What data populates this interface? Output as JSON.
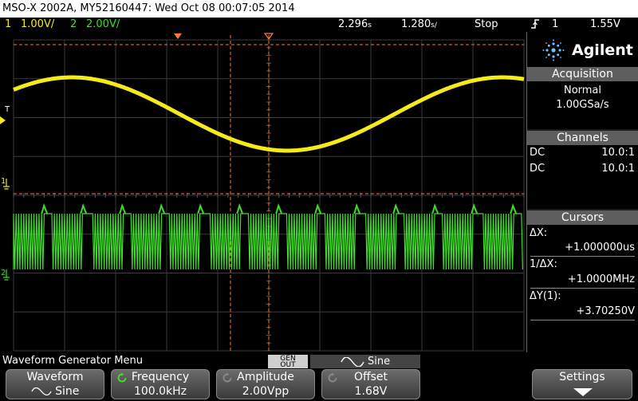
{
  "title_bar": {
    "text": "MSO-X 2002A, MY52160447: Wed Oct 08 00:07:05 2014"
  },
  "status_bar": {
    "ch1_num": "1",
    "ch1_scale": "1.00V/",
    "ch2_num": "2",
    "ch2_scale": "2.00V/",
    "time_position": "2.296",
    "time_position_unit": "s",
    "time_scale": "1.280",
    "time_scale_unit": "s/",
    "run_state": "Stop",
    "trigger_channel": "1",
    "trigger_level": "1.55V"
  },
  "screen": {
    "markers": {
      "trigger": "T",
      "ch1": "1",
      "ch2": "2"
    },
    "colors": {
      "ch1": "#f5ea1a",
      "ch2": "#3fdc2a",
      "cursor": "#ff7a2e",
      "grid": "#3a3a3a"
    }
  },
  "panel": {
    "brand": "Agilent",
    "acquisition": {
      "header": "Acquisition",
      "mode": "Normal",
      "rate": "1.00GSa/s"
    },
    "channels": {
      "header": "Channels",
      "rows": [
        {
          "coupling": "DC",
          "probe": "10.0:1"
        },
        {
          "coupling": "DC",
          "probe": "10.0:1"
        }
      ]
    },
    "cursors": {
      "header": "Cursors",
      "dx_label": "ΔX:",
      "dx_value": "+1.000000us",
      "inv_dx_label": "1/ΔX:",
      "inv_dx_value": "+1.0000MHz",
      "dy_label": "ΔY(1):",
      "dy_value": "+3.70250V"
    }
  },
  "menu": {
    "title": "Waveform Generator Menu",
    "gen_out": "GEN OUT",
    "waveform_header": "Sine",
    "softkeys": [
      {
        "label": "Waveform",
        "value": "Sine"
      },
      {
        "label": "Frequency",
        "value": "100.0kHz"
      },
      {
        "label": "Amplitude",
        "value": "2.00Vpp"
      },
      {
        "label": "Offset",
        "value": "1.68V"
      },
      {
        "label": "Settings",
        "value": ""
      }
    ]
  }
}
